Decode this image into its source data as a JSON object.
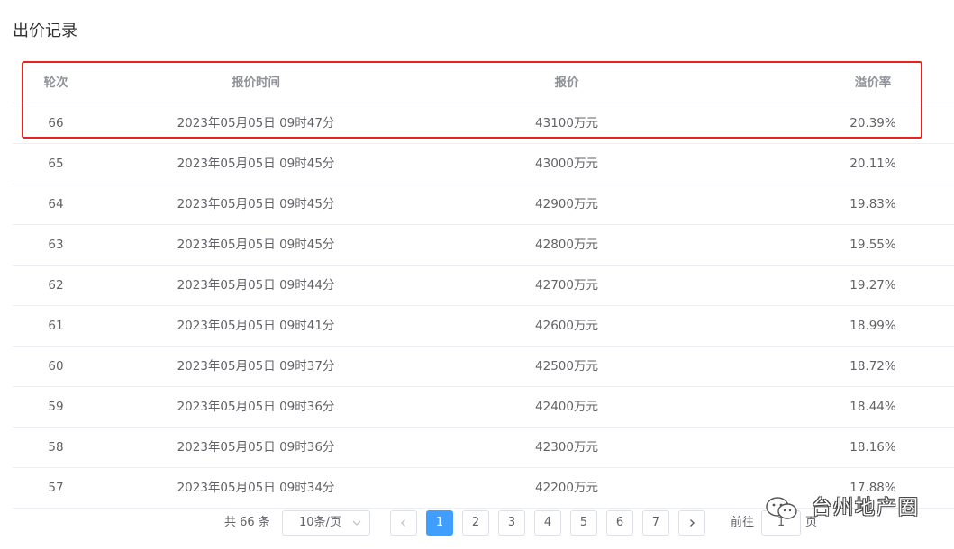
{
  "title": "出价记录",
  "table": {
    "headers": {
      "round": "轮次",
      "time": "报价时间",
      "price": "报价",
      "rate": "溢价率"
    },
    "rows": [
      {
        "round": "66",
        "time": "2023年05月05日 09时47分",
        "price": "43100万元",
        "rate": "20.39%"
      },
      {
        "round": "65",
        "time": "2023年05月05日 09时45分",
        "price": "43000万元",
        "rate": "20.11%"
      },
      {
        "round": "64",
        "time": "2023年05月05日 09时45分",
        "price": "42900万元",
        "rate": "19.83%"
      },
      {
        "round": "63",
        "time": "2023年05月05日 09时45分",
        "price": "42800万元",
        "rate": "19.55%"
      },
      {
        "round": "62",
        "time": "2023年05月05日 09时44分",
        "price": "42700万元",
        "rate": "19.27%"
      },
      {
        "round": "61",
        "time": "2023年05月05日 09时41分",
        "price": "42600万元",
        "rate": "18.99%"
      },
      {
        "round": "60",
        "time": "2023年05月05日 09时37分",
        "price": "42500万元",
        "rate": "18.72%"
      },
      {
        "round": "59",
        "time": "2023年05月05日 09时36分",
        "price": "42400万元",
        "rate": "18.44%"
      },
      {
        "round": "58",
        "time": "2023年05月05日 09时36分",
        "price": "42300万元",
        "rate": "18.16%"
      },
      {
        "round": "57",
        "time": "2023年05月05日 09时34分",
        "price": "42200万元",
        "rate": "17.88%"
      }
    ]
  },
  "pagination": {
    "total": "共 66 条",
    "page_size": "10条/页",
    "pages": [
      "1",
      "2",
      "3",
      "4",
      "5",
      "6",
      "7"
    ],
    "current": "1",
    "goto_label": "前往",
    "goto_value": "1",
    "goto_suffix": "页"
  },
  "watermark": {
    "text": "台州地产圈"
  },
  "colors": {
    "accent": "#409eff",
    "highlight": "#e8231f"
  }
}
